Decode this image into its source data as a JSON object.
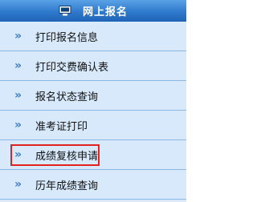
{
  "header": {
    "title": "网上报名",
    "icon": "monitor-icon"
  },
  "menu": {
    "arrow_glyph": "»",
    "items": [
      {
        "label": "打印报名信息"
      },
      {
        "label": "打印交费确认表"
      },
      {
        "label": "报名状态查询"
      },
      {
        "label": "准考证打印"
      },
      {
        "label": "成绩复核申请",
        "highlighted": true,
        "highlight_color": "#e32222"
      },
      {
        "label": "历年成绩查询"
      }
    ]
  },
  "colors": {
    "header_bg": "#2f79cc",
    "panel_bg": "#d7e9fb",
    "arrow": "#3b7fc9",
    "divider": "#8ab7e3"
  }
}
